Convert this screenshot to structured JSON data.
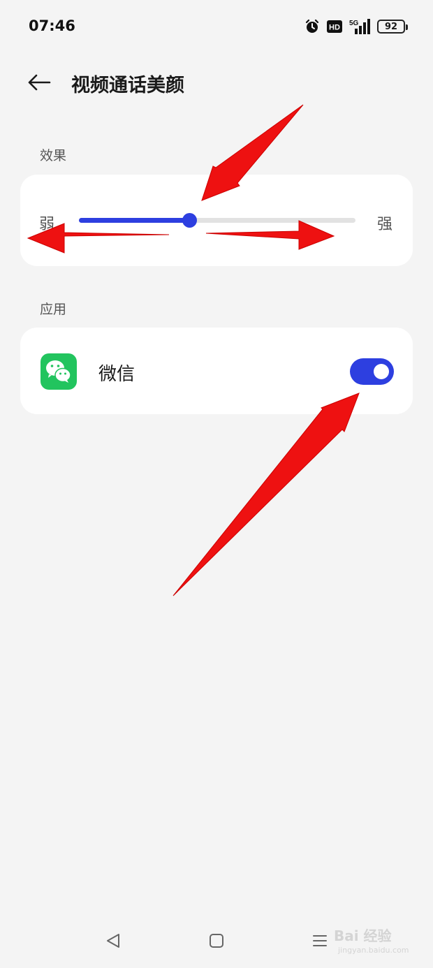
{
  "status_bar": {
    "time": "07:46",
    "hd_label": "HD",
    "network_label": "5G",
    "battery_level": "92",
    "icons": [
      "alarm-icon",
      "hd-icon",
      "signal-5g-icon",
      "battery-icon"
    ]
  },
  "header": {
    "back_icon": "arrow-left-icon",
    "title": "视频通话美颜"
  },
  "effect_section": {
    "label": "效果",
    "slider": {
      "min_label": "弱",
      "max_label": "强",
      "value_fraction": 0.4
    }
  },
  "apps_section": {
    "label": "应用",
    "items": [
      {
        "name": "微信",
        "icon": "wechat-icon",
        "enabled": true
      }
    ]
  },
  "navigation_bar": {
    "icons": [
      "back-triangle-icon",
      "home-square-icon",
      "menu-lines-icon"
    ]
  },
  "watermark": {
    "text": "Bai 经验",
    "subtext": "jingyan.baidu.com"
  },
  "colors": {
    "accent": "#2d3fe0",
    "background": "#f4f4f4",
    "card": "#ffffff",
    "wechat_green": "#22c45e",
    "annotation_red": "#ee1111"
  }
}
